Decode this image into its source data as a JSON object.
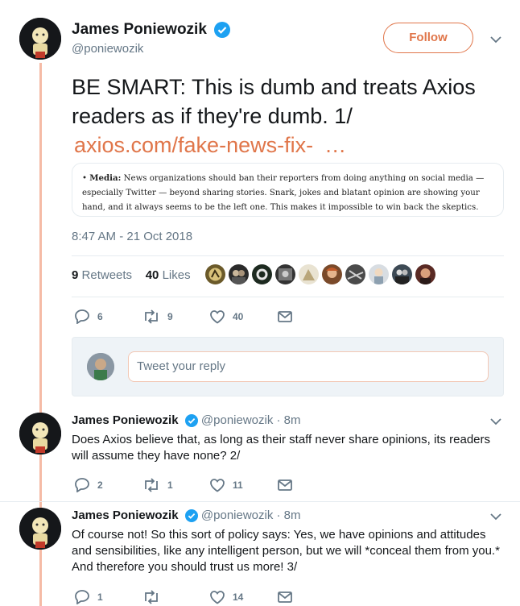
{
  "main_tweet": {
    "author_name": "James Poniewozik",
    "author_handle": "@poniewozik",
    "follow_label": "Follow",
    "text": "BE SMART: This is dumb and treats Axios readers as if they're dumb. 1/",
    "link": "axios.com/fake-news-fix-",
    "link_ellipsis": "…",
    "quote": {
      "label": "Media:",
      "body": "News organizations should ban their reporters from doing anything on social media — especially Twitter — beyond sharing stories. Snark, jokes and blatant opinion are showing your hand, and it always seems to be the left one. This makes it impossible to win back the skeptics."
    },
    "timestamp": "8:47 AM - 21 Oct 2018",
    "retweets_count": "9",
    "retweets_label": "Retweets",
    "likes_count": "40",
    "likes_label": "Likes",
    "actions": {
      "replies": "6",
      "retweets": "9",
      "likes": "40"
    }
  },
  "reply_box": {
    "placeholder": "Tweet your reply"
  },
  "replies": [
    {
      "author_name": "James Poniewozik",
      "meta": "@poniewozik · 8m",
      "text": "Does Axios believe that, as long as their staff never share opinions, its readers will assume they have none? 2/",
      "actions": {
        "replies": "2",
        "retweets": "1",
        "likes": "11"
      }
    },
    {
      "author_name": "James Poniewozik",
      "meta": "@poniewozik · 8m",
      "text": "Of course not! So this sort of policy says: Yes, we have opinions and attitudes and sensibilities, like any intelligent person, but we will *conceal them from you.* And therefore you should trust us more! 3/",
      "actions": {
        "replies": "1",
        "retweets": "",
        "likes": "14"
      }
    }
  ],
  "colors": {
    "accent": "#e0764a",
    "verified": "#1da1f2",
    "thread": "#f5bba6",
    "muted": "#657786"
  }
}
